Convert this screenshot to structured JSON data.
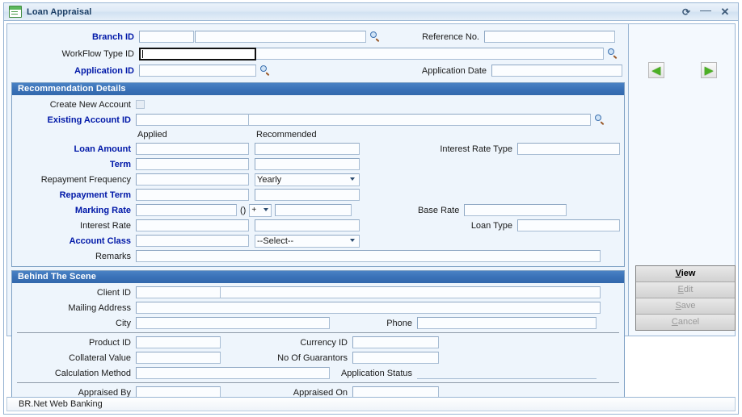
{
  "window": {
    "title": "Loan Appraisal",
    "icon": "document-icon",
    "controls": {
      "refresh": "⟳",
      "minimize": "—",
      "close": "✕"
    }
  },
  "top_fields": {
    "branch_id": {
      "label": "Branch ID",
      "required": true,
      "value": "",
      "value2": "",
      "search": "search-icon"
    },
    "reference_no": {
      "label": "Reference No.",
      "required": false,
      "value": ""
    },
    "workflow_type_id": {
      "label": "WorkFlow Type ID",
      "required": false,
      "value": "",
      "focused": true,
      "search": "search-icon"
    },
    "application_id": {
      "label": "Application ID",
      "required": true,
      "value": "",
      "search": "search-icon"
    },
    "application_date": {
      "label": "Application Date",
      "required": false,
      "value": ""
    }
  },
  "recommendation": {
    "header": "Recommendation Details",
    "create_new_account": {
      "label": "Create New Account",
      "checked": false
    },
    "existing_account_id": {
      "label": "Existing Account ID",
      "required": true,
      "value": "",
      "value2": "",
      "search": "search-icon"
    },
    "column_headers": {
      "applied": "Applied",
      "recommended": "Recommended"
    },
    "rows": [
      {
        "label": "Loan Amount",
        "required": true,
        "applied": "",
        "recommended": "",
        "rec_type": "input"
      },
      {
        "label": "Term",
        "required": true,
        "applied": "",
        "recommended": "",
        "rec_type": "input"
      },
      {
        "label": "Repayment Frequency",
        "required": false,
        "applied": "",
        "recommended": "Yearly",
        "rec_type": "select"
      },
      {
        "label": "Repayment Term",
        "required": true,
        "applied": "",
        "recommended": "",
        "rec_type": "input"
      }
    ],
    "marking_rate": {
      "label": "Marking Rate",
      "required": true,
      "applied": "",
      "paren": "()",
      "operator": "+",
      "rec_value": ""
    },
    "interest_rate": {
      "label": "Interest Rate",
      "required": false,
      "applied": "",
      "recommended": ""
    },
    "account_class": {
      "label": "Account Class",
      "required": true,
      "applied": "",
      "recommended": "--Select--"
    },
    "remarks": {
      "label": "Remarks",
      "required": false,
      "value": ""
    },
    "right_fields": {
      "interest_rate_type": {
        "label": "Interest Rate Type",
        "value": ""
      },
      "base_rate": {
        "label": "Base Rate",
        "value": ""
      },
      "loan_type": {
        "label": "Loan Type",
        "value": ""
      }
    }
  },
  "behind_the_scene": {
    "header": "Behind The Scene",
    "client_id": {
      "label": "Client ID",
      "value": "",
      "value2": ""
    },
    "mailing_address": {
      "label": "Mailing Address",
      "value": ""
    },
    "city": {
      "label": "City",
      "value": ""
    },
    "phone": {
      "label": "Phone",
      "value": ""
    },
    "product_id": {
      "label": "Product ID",
      "value": ""
    },
    "currency_id": {
      "label": "Currency ID",
      "value": ""
    },
    "collateral_value": {
      "label": "Collateral Value",
      "value": ""
    },
    "no_of_guarantors": {
      "label": "No Of Guarantors",
      "value": ""
    },
    "calculation_method": {
      "label": "Calculation Method",
      "value": ""
    },
    "application_status": {
      "label": "Application Status",
      "value": ""
    },
    "appraised_by": {
      "label": "Appraised By",
      "value": ""
    },
    "appraised_on": {
      "label": "Appraised On",
      "value": ""
    }
  },
  "nav": {
    "back": "◀",
    "forward": "▶"
  },
  "actions": [
    {
      "label": "View",
      "accel": "V",
      "rest": "iew",
      "enabled": true
    },
    {
      "label": "Edit",
      "accel": "E",
      "rest": "dit",
      "enabled": false
    },
    {
      "label": "Save",
      "accel": "S",
      "rest": "ave",
      "enabled": false
    },
    {
      "label": "Cancel",
      "accel": "C",
      "rest": "ancel",
      "enabled": false
    }
  ],
  "statusbar": {
    "text": "BR.Net Web Banking"
  },
  "colors": {
    "section_header": "#3a72b8",
    "required_label": "#0018a8",
    "panel_bg": "#eef5fc",
    "field_bg": "#fbfdff"
  }
}
